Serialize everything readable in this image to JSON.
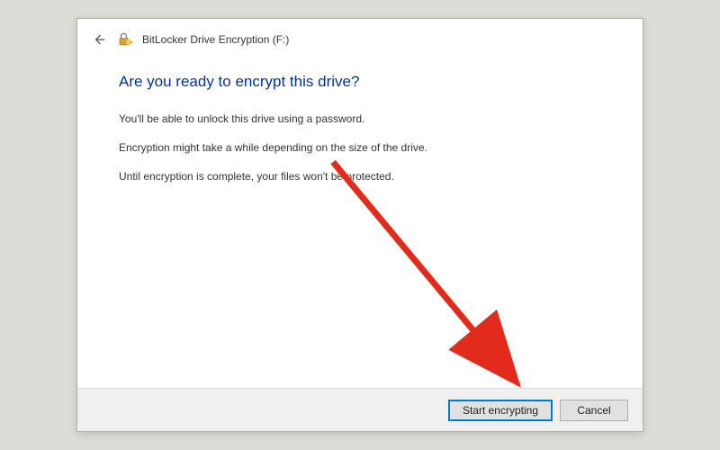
{
  "header": {
    "title": "BitLocker Drive Encryption (F:)"
  },
  "content": {
    "heading": "Are you ready to encrypt this drive?",
    "line1": "You'll be able to unlock this drive using a password.",
    "line2": "Encryption might take a while depending on the size of the drive.",
    "line3": "Until encryption is complete, your files won't be protected."
  },
  "footer": {
    "primary_label": "Start encrypting",
    "cancel_label": "Cancel"
  },
  "colors": {
    "heading": "#003399",
    "accent": "#0078d7",
    "annotation": "#e22b1a"
  }
}
